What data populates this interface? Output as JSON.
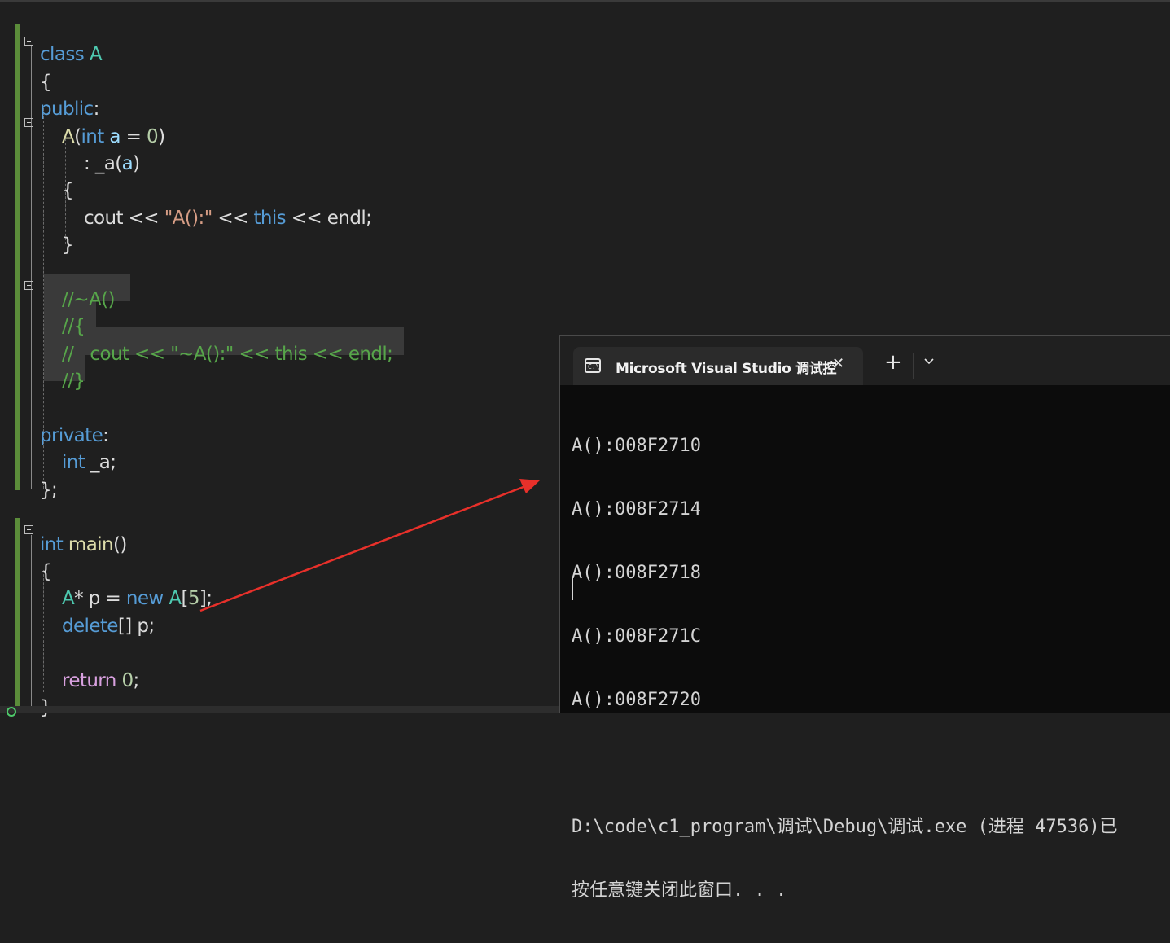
{
  "editor": {
    "lines": [
      [
        [
          "kw",
          "class "
        ],
        [
          "cls",
          "A"
        ]
      ],
      [
        [
          "",
          "{"
        ]
      ],
      [
        [
          "kw",
          "public"
        ],
        [
          "",
          ":"
        ]
      ],
      [
        [
          "fn",
          "A"
        ],
        [
          "",
          "("
        ],
        [
          "kw",
          "int "
        ],
        [
          "var",
          "a"
        ],
        [
          "",
          " = "
        ],
        [
          "num",
          "0"
        ],
        [
          "",
          ")"
        ]
      ],
      [
        [
          "",
          ": "
        ],
        [
          "",
          "_a"
        ],
        [
          "",
          "("
        ],
        [
          "var",
          "a"
        ],
        [
          "",
          ")"
        ]
      ],
      [
        [
          "",
          "{"
        ]
      ],
      [
        [
          "",
          "cout << "
        ],
        [
          "str",
          "\"A():\""
        ],
        [
          "",
          " << "
        ],
        [
          "kw",
          "this"
        ],
        [
          "",
          " << endl;"
        ]
      ],
      [
        [
          "",
          "}"
        ]
      ],
      [
        [
          "cm",
          "//~A()"
        ]
      ],
      [
        [
          "cm",
          "//{"
        ]
      ],
      [
        [
          "cm",
          "//   cout << \"~A():\" << this << endl;"
        ]
      ],
      [
        [
          "cm",
          "//}"
        ]
      ],
      [
        [
          "kw",
          "private"
        ],
        [
          "",
          ":"
        ]
      ],
      [
        [
          "kw",
          "int "
        ],
        [
          "",
          "_a;"
        ]
      ],
      [
        [
          "",
          "};"
        ]
      ],
      [
        [
          "kw",
          "int "
        ],
        [
          "fn",
          "main"
        ],
        [
          "",
          "()"
        ]
      ],
      [
        [
          "",
          "{"
        ]
      ],
      [
        [
          "cls",
          "A"
        ],
        [
          "",
          "* p = "
        ],
        [
          "kw",
          "new "
        ],
        [
          "cls",
          "A"
        ],
        [
          "",
          "["
        ],
        [
          "num",
          "5"
        ],
        [
          "",
          "];"
        ]
      ],
      [
        [
          "kw",
          "delete"
        ],
        [
          "",
          "[] p;"
        ]
      ],
      [
        [
          "ctl",
          "return "
        ],
        [
          "num",
          "0"
        ],
        [
          "",
          ";"
        ]
      ],
      [
        [
          "",
          "}"
        ]
      ]
    ]
  },
  "terminal": {
    "tab_title": "Microsoft Visual Studio 调试控",
    "tab_icon_text": "C:\\",
    "close_glyph": "✕",
    "new_tab_glyph": "+",
    "output": [
      "A():008F2710",
      "A():008F2714",
      "A():008F2718",
      "A():008F271C",
      "A():008F2720",
      "",
      "D:\\code\\c1_program\\调试\\Debug\\调试.exe (进程 47536)已",
      "按任意键关闭此窗口. . ."
    ]
  },
  "colors": {
    "accent_arrow": "#e8302a",
    "changebar": "#5b8c3a",
    "keyword": "#569cd6",
    "type": "#4ec9b0",
    "comment": "#57a64a"
  }
}
